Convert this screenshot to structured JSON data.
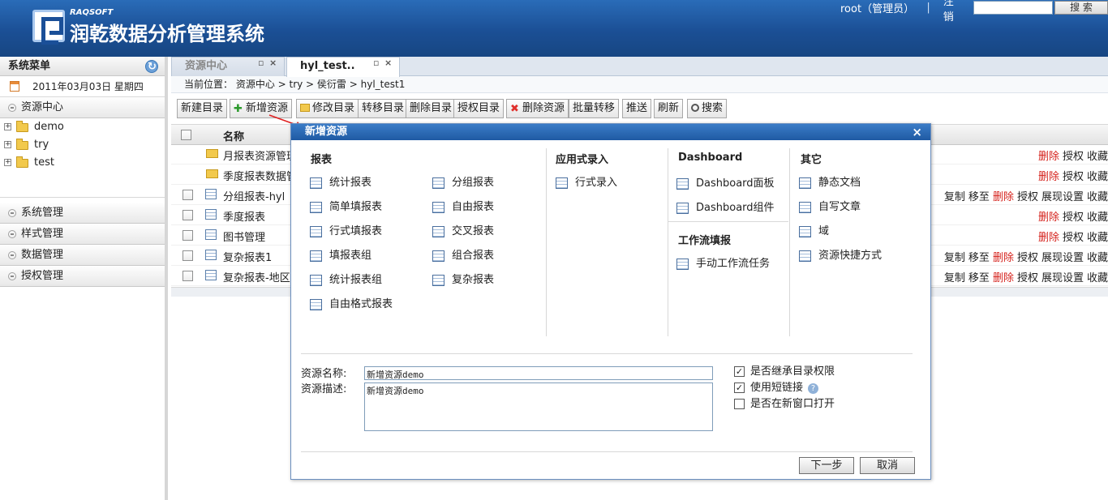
{
  "header": {
    "brand_en": "RAQSOFT",
    "brand_cn": "润乾数据分析管理系统",
    "user": "root（管理员）",
    "separator": "|",
    "logout": "注销",
    "search_placeholder": "",
    "search_button": "搜 索"
  },
  "sidebar": {
    "title": "系统菜单",
    "date": "2011年03月03日  星期四",
    "resource_center": "资源中心",
    "tree": [
      {
        "label": "demo"
      },
      {
        "label": "try"
      },
      {
        "label": "test"
      }
    ],
    "sections": [
      "系统管理",
      "样式管理",
      "数据管理",
      "授权管理"
    ]
  },
  "tabs": [
    {
      "label": "资源中心"
    },
    {
      "label": "hyl_test.."
    }
  ],
  "breadcrumb": "当前位置：  资源中心  > try > 侯衍雷  > hyl_test1",
  "toolbar": {
    "new_dir": "新建目录",
    "new_res": "新增资源",
    "edit_dir": "修改目录",
    "move_dir": "转移目录",
    "del_dir": "删除目录",
    "auth_dir": "授权目录",
    "del_res": "删除资源",
    "batch_move": "批量转移",
    "push": "推送",
    "refresh": "刷新",
    "search": "搜索"
  },
  "grid": {
    "col_name": "名称",
    "rows": [
      {
        "name": "月报表资源管理",
        "type": "folder",
        "acts": [
          {
            "t": "删除",
            "red": true
          },
          {
            "t": "授权"
          },
          {
            "t": "收藏"
          }
        ]
      },
      {
        "name": "季度报表数据管",
        "type": "folder",
        "acts": [
          {
            "t": "删除",
            "red": true
          },
          {
            "t": "授权"
          },
          {
            "t": "收藏"
          }
        ]
      },
      {
        "name": "分组报表-hyl",
        "type": "report",
        "acts": [
          {
            "t": "复制"
          },
          {
            "t": "移至"
          },
          {
            "t": "删除",
            "red": true
          },
          {
            "t": "授权"
          },
          {
            "t": "展现设置"
          },
          {
            "t": "收藏"
          }
        ]
      },
      {
        "name": "季度报表",
        "type": "report",
        "acts": [
          {
            "t": "删除",
            "red": true
          },
          {
            "t": "授权"
          },
          {
            "t": "收藏"
          }
        ]
      },
      {
        "name": "图书管理",
        "type": "report",
        "acts": [
          {
            "t": "删除",
            "red": true
          },
          {
            "t": "授权"
          },
          {
            "t": "收藏"
          }
        ]
      },
      {
        "name": "复杂报表1",
        "type": "report",
        "acts": [
          {
            "t": "复制"
          },
          {
            "t": "移至"
          },
          {
            "t": "删除",
            "red": true
          },
          {
            "t": "授权"
          },
          {
            "t": "展现设置"
          },
          {
            "t": "收藏"
          }
        ]
      },
      {
        "name": "复杂报表-地区",
        "type": "report",
        "acts": [
          {
            "t": "复制"
          },
          {
            "t": "移至"
          },
          {
            "t": "删除",
            "red": true
          },
          {
            "t": "授权"
          },
          {
            "t": "展现设置"
          },
          {
            "t": "收藏"
          }
        ]
      }
    ]
  },
  "dialog": {
    "title": "新增资源",
    "close": "×",
    "report_title": "报表",
    "reports_left": [
      "统计报表",
      "简单填报表",
      "行式填报表",
      "填报表组",
      "统计报表组",
      "自由格式报表"
    ],
    "reports_right": [
      "分组报表",
      "自由报表",
      "交叉报表",
      "组合报表",
      "复杂报表"
    ],
    "app_title": "应用式录入",
    "app_items": [
      "行式录入"
    ],
    "dash_title": "Dashboard",
    "dash_items": [
      "Dashboard面板",
      "Dashboard组件"
    ],
    "wf_title": "工作流填报",
    "wf_items": [
      "手动工作流任务"
    ],
    "other_title": "其它",
    "other_items": [
      "静态文档",
      "自写文章",
      "域",
      "资源快捷方式"
    ],
    "name_label": "资源名称:",
    "name_value": "新增资源demo",
    "desc_label": "资源描述:",
    "desc_value": "新增资源demo",
    "inherit": "是否继承目录权限",
    "short_link": "使用短链接",
    "new_window": "是否在新窗口打开",
    "next": "下一步",
    "cancel": "取消"
  }
}
